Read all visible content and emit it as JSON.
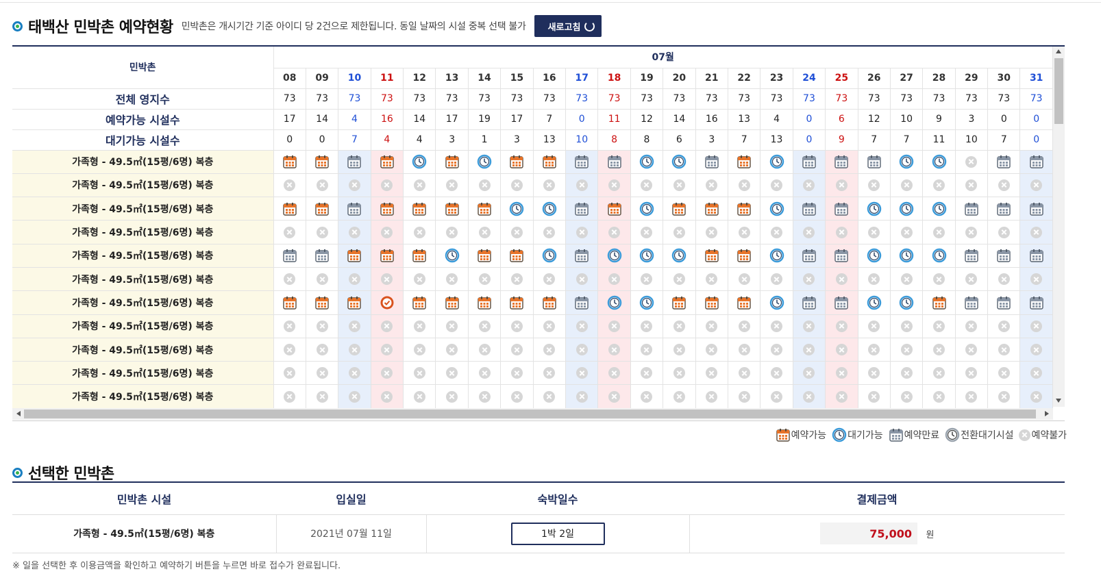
{
  "header": {
    "title": "태백산 민박촌 예약현황",
    "notice": "민박촌은 개시기간 기준 아이디 당 2건으로 제한됩니다. 동일 날짜의 시설 중복 선택 불가",
    "refresh_label": "새로고침"
  },
  "grid": {
    "col_label": "민박촌",
    "month": "07월",
    "days": [
      "08",
      "09",
      "10",
      "11",
      "12",
      "13",
      "14",
      "15",
      "16",
      "17",
      "18",
      "19",
      "20",
      "21",
      "22",
      "23",
      "24",
      "25",
      "26",
      "27",
      "28",
      "29",
      "30",
      "31"
    ],
    "day_types": [
      "",
      "",
      "sat",
      "sun",
      "",
      "",
      "",
      "",
      "",
      "sat",
      "sun",
      "",
      "",
      "",
      "",
      "",
      "sat",
      "sun",
      "",
      "",
      "",
      "",
      "",
      "sat"
    ],
    "stat_rows": [
      {
        "label": "전체 영지수",
        "values": [
          "73",
          "73",
          "73",
          "73",
          "73",
          "73",
          "73",
          "73",
          "73",
          "73",
          "73",
          "73",
          "73",
          "73",
          "73",
          "73",
          "73",
          "73",
          "73",
          "73",
          "73",
          "73",
          "73",
          "73"
        ]
      },
      {
        "label": "예약가능 시설수",
        "values": [
          "17",
          "14",
          "4",
          "16",
          "14",
          "17",
          "19",
          "17",
          "7",
          "0",
          "11",
          "12",
          "14",
          "16",
          "13",
          "4",
          "0",
          "6",
          "12",
          "10",
          "9",
          "3",
          "0",
          "0"
        ]
      },
      {
        "label": "대기가능 시설수",
        "values": [
          "0",
          "0",
          "7",
          "4",
          "4",
          "3",
          "1",
          "3",
          "13",
          "10",
          "8",
          "8",
          "6",
          "3",
          "7",
          "13",
          "0",
          "9",
          "7",
          "7",
          "11",
          "10",
          "7",
          "0"
        ]
      }
    ],
    "facility_label": "가족형 - 49.5㎡(15평/6명) 복층",
    "rows": [
      "CCRCWCWCCRRWWRCWRRRWWXRR",
      "XXXXXXXXXXXXXXXXXXXXXXXX",
      "CCRCCCCWWRCWCCCWRRWWWRRR",
      "XXXXXXXXXXXXXXXXXXXXXXXX",
      "RRCCCWCCWRWWWCCWRRWWWRRR",
      "XXXXXXXXXXXXXXXXXXXXXXXX",
      "CCCSCCCCCRWWCCCWRRWWCRRR",
      "XXXXXXXXXXXXXXXXXXXXXXXX",
      "XXXXXXXXXXXXXXXXXXXXXXXX",
      "XXXXXXXXXXXXXXXXXXXXXXXX",
      "XXXXXXXXXXXXXXXXXXXXXXXX"
    ]
  },
  "legend": {
    "available": "예약가능",
    "waitable": "대기가능",
    "closed": "예약만료",
    "transfer": "전환대기시설",
    "unavailable": "예약불가"
  },
  "selected": {
    "title": "선택한 민박촌",
    "headers": [
      "민박촌 시설",
      "입실일",
      "숙박일수",
      "결제금액"
    ],
    "facility": "가족형 - 49.5㎡(15평/6명) 복층",
    "checkin": "2021년 07월 11일",
    "nights": "1박 2일",
    "price": "75,000",
    "currency": "원",
    "footnote": "※ 일을 선택한 후 이용금액을 확인하고 예약하기 버튼을 누르면 바로 접수가 완료됩니다."
  },
  "colors": {
    "navy": "#1f2e5c",
    "saturday": "#1f4fd6",
    "sunday": "#cc1111",
    "sat_bg": "#e7effb",
    "sun_bg": "#fde8ea",
    "label_bg": "#fcf9e6"
  },
  "icons": {
    "C": "calendar-available-icon",
    "R": "calendar-closed-icon",
    "W": "clock-waitable-icon",
    "S": "selected-check-icon",
    "X": "unavailable-x-icon"
  }
}
